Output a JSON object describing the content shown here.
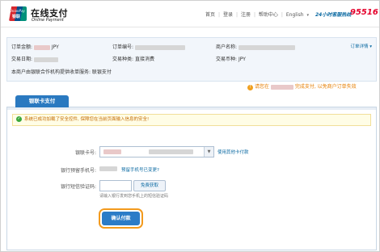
{
  "header": {
    "brand_cn": "在线支付",
    "brand_en": "Online Payment",
    "logo_text": "UnionPay",
    "logo_cn": "银联",
    "nav": [
      "首页",
      "登录",
      "注册",
      "帮助中心",
      "English"
    ],
    "hotline_label": "24小时客服热线",
    "hotline_number": "95516"
  },
  "order": {
    "amount_label": "订单金额:",
    "amount_currency": "JPY",
    "order_no_label": "订单编号:",
    "merchant_label": "商户名称:",
    "detail_link": "订单详情",
    "date_label": "交易日期:",
    "type_label": "交易种类:",
    "type_value": "直接消费",
    "currency_label": "交易币种:",
    "currency_value": "JPY",
    "service_note": "本商户由银联合作机构提供收单服务: 联银支付"
  },
  "notice": {
    "prefix": "请您在",
    "suffix": "完成支付, 以免商户订单失效"
  },
  "tab": {
    "label": "银联卡支付"
  },
  "secure_msg": "系统已成功加载了安全控件, 保障您在当前页面输入信息的安全!",
  "form": {
    "card_label": "银联卡号:",
    "other_card_link": "使用其他卡付款",
    "phone_label": "银行预留手机号:",
    "phone_changed_link": "预留手机号已变更?",
    "sms_label": "银行短信验证码:",
    "get_code_button": "免费获取",
    "sms_hint": "请输入银行发到您手机上的短信验证码",
    "confirm_button": "确认付款"
  },
  "colors": {
    "brand_red": "#e4002b",
    "link_blue": "#0b6aa2",
    "tab_blue": "#2a79c0",
    "highlight_orange": "#f39a1d"
  }
}
